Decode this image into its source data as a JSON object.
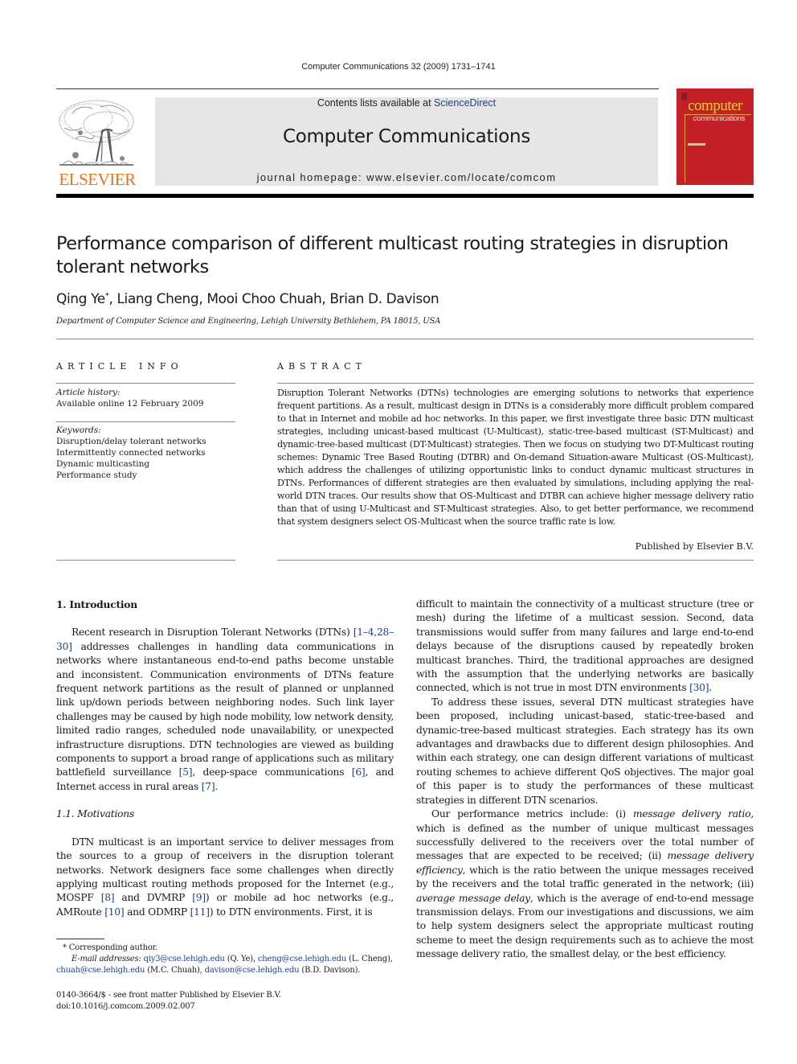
{
  "running_head": "Computer Communications 32 (2009) 1731–1741",
  "masthead": {
    "publisher_logo_text": "ELSEVIER",
    "contents_prefix": "Contents lists available at ",
    "contents_link": "ScienceDirect",
    "journal_title": "Computer Communications",
    "homepage": "journal homepage: www.elsevier.com/locate/comcom",
    "cover": {
      "line1": "computer",
      "line2": "communications"
    },
    "colors": {
      "elsevier_orange": "#e8731c",
      "cover_red": "#c42028",
      "cover_yellow": "#f4d22a",
      "link_blue": "#1f3f8f",
      "banner_gray": "#e6e6e6"
    }
  },
  "article": {
    "title": "Performance comparison of different multicast routing strategies in disruption tolerant networks",
    "authors": "Qing Ye",
    "authors_marker": "*",
    "authors_rest": ", Liang Cheng, Mooi Choo Chuah, Brian D. Davison",
    "affiliation": "Department of Computer Science and Engineering, Lehigh University Bethlehem, PA 18015, USA"
  },
  "article_info": {
    "heading": "ARTICLE INFO",
    "history_label": "Article history:",
    "history_value": "Available online 12 February 2009",
    "keywords_label": "Keywords:",
    "keywords": [
      "Disruption/delay tolerant networks",
      "Intermittently connected networks",
      "Dynamic multicasting",
      "Performance study"
    ]
  },
  "abstract": {
    "heading": "ABSTRACT",
    "text": "Disruption Tolerant Networks (DTNs) technologies are emerging solutions to networks that experience frequent partitions. As a result, multicast design in DTNs is a considerably more difficult problem compared to that in Internet and mobile ad hoc networks. In this paper, we first investigate three basic DTN multicast strategies, including unicast-based multicast (U-Multicast), static-tree-based multicast (ST-Multicast) and dynamic-tree-based multicast (DT-Multicast) strategies. Then we focus on studying two DT-Multicast routing schemes: Dynamic Tree Based Routing (DTBR) and On-demand Situation-aware Multicast (OS-Multicast), which address the challenges of utilizing opportunistic links to conduct dynamic multicast structures in DTNs. Performances of different strategies are then evaluated by simulations, including applying the real-world DTN traces. Our results show that OS-Multicast and DTBR can achieve higher message delivery ratio than that of using U-Multicast and ST-Multicast strategies. Also, to get better performance, we recommend that system designers select OS-Multicast when the source traffic rate is low.",
    "published_by": "Published by Elsevier B.V."
  },
  "body": {
    "section1_heading": "1. Introduction",
    "p1": [
      "Recent research in Disruption Tolerant Networks (DTNs) ",
      "[1–4,28–30]",
      " addresses challenges in handling data communications in networks where instantaneous end-to-end paths become unstable and inconsistent. Communication environments of DTNs feature frequent network partitions as the result of planned or unplanned link up/down periods between neighboring nodes. Such link layer challenges may be caused by high node mobility, low network density, limited radio ranges, scheduled node unavailability, or unexpected infrastructure disruptions. DTN technologies are viewed as building components to support a broad range of applications such as military battlefield surveillance ",
      "[5]",
      ", deep-space communications ",
      "[6]",
      ", and Internet access in rural areas ",
      "[7]",
      "."
    ],
    "section11_heading": "1.1. Motivations",
    "p2": [
      "DTN multicast is an important service to deliver messages from the sources to a group of receivers in the disruption tolerant networks. Network designers face some challenges when directly applying multicast routing methods proposed for the Internet (e.g., MOSPF ",
      "[8]",
      " and DVMRP ",
      "[9]",
      ") or mobile ad hoc networks (e.g., AMRoute ",
      "[10]",
      " and ODMRP ",
      "[11]",
      ") to DTN environments. First, it is"
    ],
    "p3": [
      "difficult to maintain the connectivity of a multicast structure (tree or mesh) during the lifetime of a multicast session. Second, data transmissions would suffer from many failures and large end-to-end delays because of the disruptions caused by repeatedly broken multicast branches. Third, the traditional approaches are designed with the assumption that the underlying networks are basically connected, which is not true in most DTN environments ",
      "[30]",
      "."
    ],
    "p4": "To address these issues, several DTN multicast strategies have been proposed, including unicast-based, static-tree-based and dynamic-tree-based multicast strategies. Each strategy has its own advantages and drawbacks due to different design philosophies. And within each strategy, one can design different variations of multicast routing schemes to achieve different QoS objectives. The major goal of this paper is to study the performances of these multicast strategies in different DTN scenarios.",
    "p5": [
      "Our performance metrics include: (i) ",
      "message delivery ratio",
      ", which is defined as the number of unique multicast messages successfully delivered to the receivers over the total number of messages that are expected to be received; (ii) ",
      "message delivery efficiency",
      ", which is the ratio between the unique messages received by the receivers and the total traffic generated in the network; (iii) ",
      "average message delay",
      ", which is the average of end-to-end message transmission delays. From our investigations and discussions, we aim to help system designers select the appropriate multicast routing scheme to meet the design requirements such as to achieve the most message delivery ratio, the smallest delay, or the best efficiency."
    ]
  },
  "footnote": {
    "marker": "*",
    "corresponding": "Corresponding author.",
    "email_label": "E-mail addresses:",
    "emails": [
      {
        "address": "qiy3@cse.lehigh.edu",
        "name": "(Q. Ye)"
      },
      {
        "address": "cheng@cse.lehigh.edu",
        "name": "(L. Cheng)"
      },
      {
        "address": "chuah@cse.lehigh.edu",
        "name": "(M.C. Chuah)"
      },
      {
        "address": "davison@cse.lehigh.edu",
        "name": "(B.D. Davison)"
      }
    ]
  },
  "front_matter": {
    "line1": "0140-3664/$ - see front matter Published by Elsevier B.V.",
    "doi": "doi:10.1016/j.comcom.2009.02.007"
  }
}
